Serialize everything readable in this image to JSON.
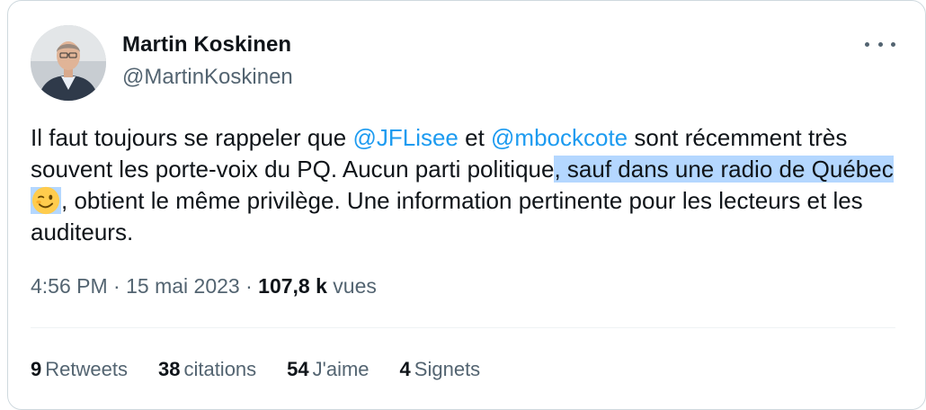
{
  "author": {
    "name": "Martin Koskinen",
    "handle": "@MartinKoskinen"
  },
  "tweet": {
    "text_1": "Il faut toujours se rappeler que ",
    "mention_1": "@JFLisee",
    "text_2": " et ",
    "mention_2": "@mbockcote",
    "text_3": " sont récemment très souvent les porte-voix du PQ.  Aucun parti politique",
    "highlight": ", sauf dans une radio de Québec",
    "emoji": "winking-face",
    "text_4": ", obtient le même privilège.  Une information pertinente pour les lecteurs et les auditeurs."
  },
  "meta": {
    "time": "4:56 PM",
    "dot": "·",
    "date": "15 mai 2023",
    "views_count": "107,8 k",
    "views_label": "vues"
  },
  "stats": {
    "retweets_count": "9",
    "retweets_label": "Retweets",
    "quotes_count": "38",
    "quotes_label": "citations",
    "likes_count": "54",
    "likes_label": "J'aime",
    "bookmarks_count": "4",
    "bookmarks_label": "Signets"
  },
  "colors": {
    "mention": "#1d9bf0",
    "highlight": "#b4d7ff",
    "secondary_text": "#536471",
    "border": "#cfd9de"
  }
}
